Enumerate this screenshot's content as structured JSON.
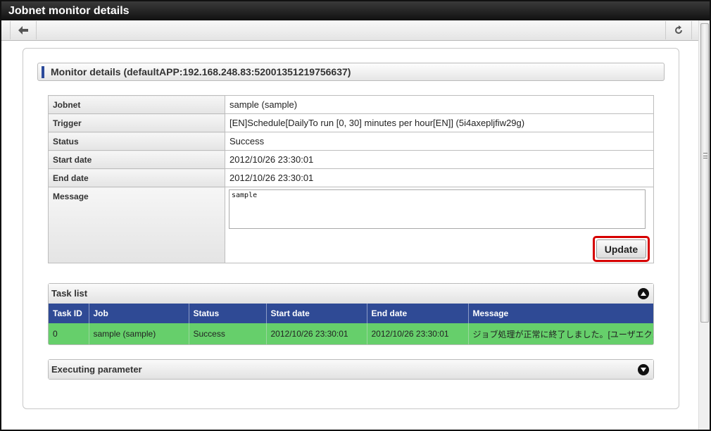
{
  "window": {
    "title": "Jobnet monitor details"
  },
  "toolbar": {
    "back_icon": "arrow-left-icon",
    "refresh_icon": "refresh-icon"
  },
  "section": {
    "title": "Monitor details (defaultAPP:192.168.248.83:52001351219756637)"
  },
  "details": {
    "jobnet_label": "Jobnet",
    "jobnet_value": "sample (sample)",
    "trigger_label": "Trigger",
    "trigger_value": "[EN]Schedule[DailyTo run [0, 30] minutes per hour[EN]] (5i4axepljfiw29g)",
    "status_label": "Status",
    "status_value": "Success",
    "start_label": "Start date",
    "start_value": "2012/10/26 23:30:01",
    "end_label": "End date",
    "end_value": "2012/10/26 23:30:01",
    "message_label": "Message",
    "message_value": "sample",
    "update_label": "Update"
  },
  "task_list": {
    "title": "Task list",
    "toggle_icon": "collapse-up-icon",
    "columns": [
      "Task ID",
      "Job",
      "Status",
      "Start date",
      "End date",
      "Message"
    ],
    "rows": [
      [
        "0",
        "sample (sample)",
        "Success",
        "2012/10/26 23:30:01",
        "2012/10/26 23:30:01",
        "ジョブ処理が正常に終了しました。[ユーザエクスポ・"
      ]
    ],
    "row_color": "#66cf6b",
    "header_color": "#2f4a95"
  },
  "executing_parameter": {
    "title": "Executing parameter",
    "toggle_icon": "expand-down-icon"
  }
}
